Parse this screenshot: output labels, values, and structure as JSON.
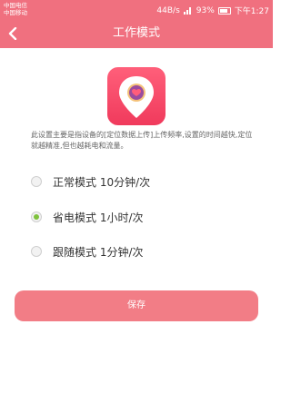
{
  "status_bar": {
    "carrier1": "中国电信",
    "carrier2": "中国移动",
    "speed": "44B/s",
    "battery": "93%",
    "time": "下午1:27"
  },
  "header": {
    "title": "工作模式",
    "back_icon": "chevron-left-icon"
  },
  "description": "此设置主要是指设备的[定位数据上传]上传频率,设置的时间越快,定位就越精准,但也越耗电和流量。",
  "options": [
    {
      "label": "正常模式 10分钟/次",
      "checked": false
    },
    {
      "label": "省电模式 1小时/次",
      "checked": true
    },
    {
      "label": "跟随模式 1分钟/次",
      "checked": false
    }
  ],
  "save_label": "保存",
  "colors": {
    "primary": "#f0707f",
    "button": "#f27d86",
    "radio_checked": "#7fc23d"
  }
}
